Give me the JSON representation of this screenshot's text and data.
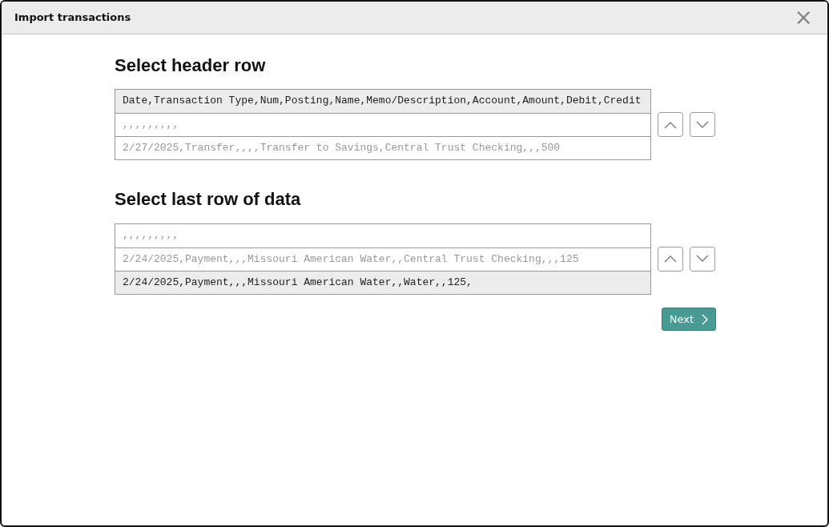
{
  "dialog": {
    "title": "Import transactions",
    "close": "×"
  },
  "sections": [
    {
      "heading": "Select header row",
      "rows": [
        {
          "text": "Date,Transaction Type,Num,Posting,Name,Memo/Description,Account,Amount,Debit,Credit",
          "selected": true
        },
        {
          "text": ",,,,,,,,,",
          "selected": false
        },
        {
          "text": "2/27/2025,Transfer,,,,Transfer to Savings,Central Trust Checking,,,500",
          "selected": false
        }
      ]
    },
    {
      "heading": "Select last row of data",
      "rows": [
        {
          "text": ",,,,,,,,,",
          "selected": false
        },
        {
          "text": "2/24/2025,Payment,,,Missouri American Water,,Central Trust Checking,,,125",
          "selected": false
        },
        {
          "text": "2/24/2025,Payment,,,Missouri American Water,,Water,,125,",
          "selected": true
        }
      ]
    }
  ],
  "next_button": {
    "label": "Next"
  }
}
